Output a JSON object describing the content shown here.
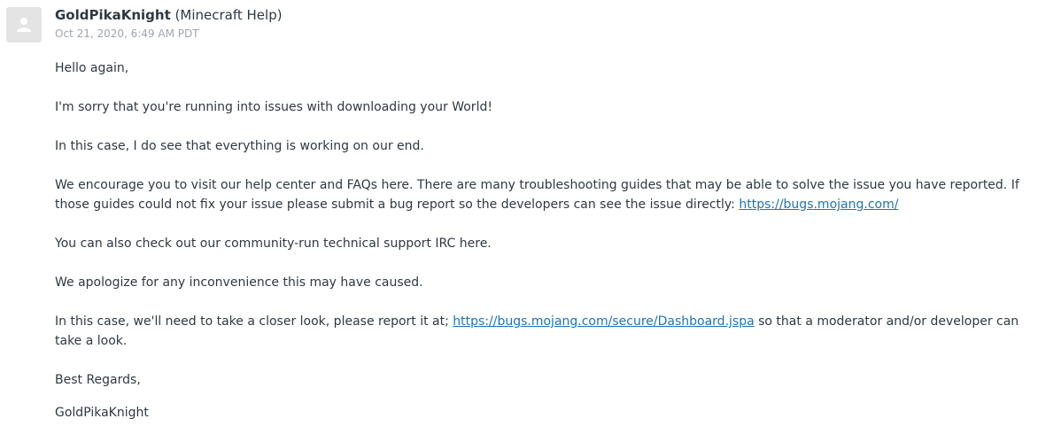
{
  "comment": {
    "author": "GoldPikaKnight",
    "author_group": "(Minecraft Help)",
    "timestamp": "Oct 21, 2020, 6:49 AM PDT",
    "avatar_icon": "user-icon",
    "paragraphs": {
      "greeting": "Hello again,",
      "apology": "I'm sorry that you're running into issues with downloading your World!",
      "status": "In this case, I do see that everything is working on our end.",
      "encourage_text": "We encourage you to visit our help center and FAQs here. There are many troubleshooting guides that may be able to solve the issue you have reported. If those guides could not fix your issue please submit a bug report so the developers can see the issue directly:",
      "encourage_link": "https://bugs.mojang.com/",
      "irc": "You can also check out our community-run technical support IRC here.",
      "apologize": "We apologize for any inconvenience this may have caused.",
      "report_text_before": "In this case, we'll need to take a closer look, please report it at;",
      "report_link": "https://bugs.mojang.com/secure/Dashboard.jspa",
      "report_text_after": "so that a moderator and/or developer can take a look.",
      "regards": "Best Regards,",
      "signature": "GoldPikaKnight"
    }
  },
  "colors": {
    "text": "#2f3941",
    "muted": "#a0a6ab",
    "link": "#1f73b7",
    "avatar_bg": "#e4e4e4"
  }
}
